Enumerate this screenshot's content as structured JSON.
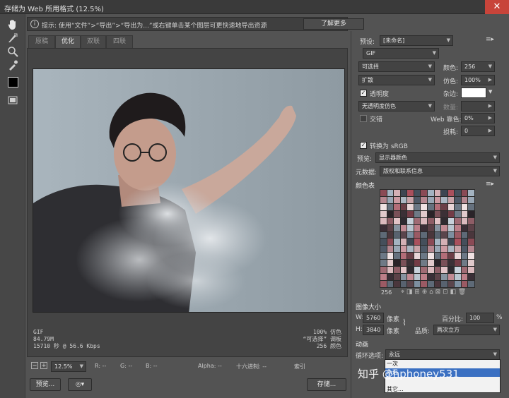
{
  "window": {
    "title": "存储为 Web 所用格式 (12.5%)",
    "close_glyph": "✕"
  },
  "hint": {
    "text": "提示: 使用“文件”>“导出”>“导出为...”或右键单击某个图层可更快速地导出资源",
    "learn_more": "了解更多"
  },
  "tabs": [
    "原稿",
    "优化",
    "双联",
    "四联"
  ],
  "image_info": {
    "left": [
      "GIF",
      "84.79M",
      "15710 秒 @ 56.6 Kbps"
    ],
    "right": [
      "100% 仿色",
      "“可选择” 调板",
      "256 颜色"
    ]
  },
  "statusbar": {
    "zoom": "12.5%",
    "r": "R: --",
    "g": "G: --",
    "b": "B: --",
    "alpha": "Alpha: --",
    "hex": "十六进制: --",
    "index": "索引"
  },
  "buttons": {
    "preview": "预览...",
    "save": "存储..."
  },
  "preset": {
    "label": "预设:",
    "value": "[未命名]"
  },
  "format": {
    "value": "GIF"
  },
  "reduction": {
    "value": "可选择"
  },
  "dither_algo": {
    "value": "扩散"
  },
  "colors": {
    "label": "颜色:",
    "value": "256"
  },
  "dither": {
    "label": "仿色:",
    "value": "100%"
  },
  "transparency": {
    "label": "透明度",
    "checked": true
  },
  "matte": {
    "label": "杂边:"
  },
  "trans_dither": {
    "value": "无透明度仿色",
    "amount_label": "数量:"
  },
  "interlaced": {
    "label": "交错",
    "checked": false
  },
  "web_snap": {
    "label": "Web 靠色:",
    "value": "0%"
  },
  "lossy": {
    "label": "损耗:",
    "value": "0"
  },
  "srgb": {
    "label": "转换为 sRGB",
    "checked": true
  },
  "preview_mode": {
    "label": "预览:",
    "value": "显示器颜色"
  },
  "metadata": {
    "label": "元数据:",
    "value": "版权和联系信息"
  },
  "color_table": {
    "title": "颜色表",
    "count": "256",
    "colors": [
      "#8a4a55",
      "#3a2e36",
      "#6f7a86",
      "#c9a3a8",
      "#7d8fa0",
      "#2f2a30",
      "#b36d78",
      "#a4b3c1",
      "#5c4148",
      "#e0c9cb",
      "#4d5866",
      "#9b5a64",
      "#c7d1da",
      "#6b3f47",
      "#d4b0b5",
      "#8793a0",
      "#2a2328",
      "#b58790",
      "#5e6a77",
      "#a06b74",
      "#e9d6d8",
      "#3d4652",
      "#c18a93",
      "#7a5058",
      "#99a7b5",
      "#4a363c",
      "#dbbabe",
      "#6c7886",
      "#a9505d",
      "#b9c5cf",
      "#3b3036",
      "#cc9aa2",
      "#58626f",
      "#8e5d66",
      "#f0e2e3",
      "#454f5b",
      "#bd7f89",
      "#733c46",
      "#aab6c2",
      "#5a454c",
      "#e2c3c7",
      "#66717e"
    ]
  },
  "image_size": {
    "title": "图像大小",
    "w_label": "W:",
    "w_value": "5760",
    "h_label": "H:",
    "h_value": "3840",
    "unit": "像素",
    "percent_label": "百分比:",
    "percent_value": "100",
    "percent_unit": "%",
    "quality_label": "品质:",
    "quality_value": "两次立方"
  },
  "animation": {
    "title": "动画",
    "loop_label": "循环选项:",
    "loop_value": "永远",
    "options": [
      "一次",
      "永远",
      "其它..."
    ]
  },
  "watermark": "知乎 @hphoney531"
}
